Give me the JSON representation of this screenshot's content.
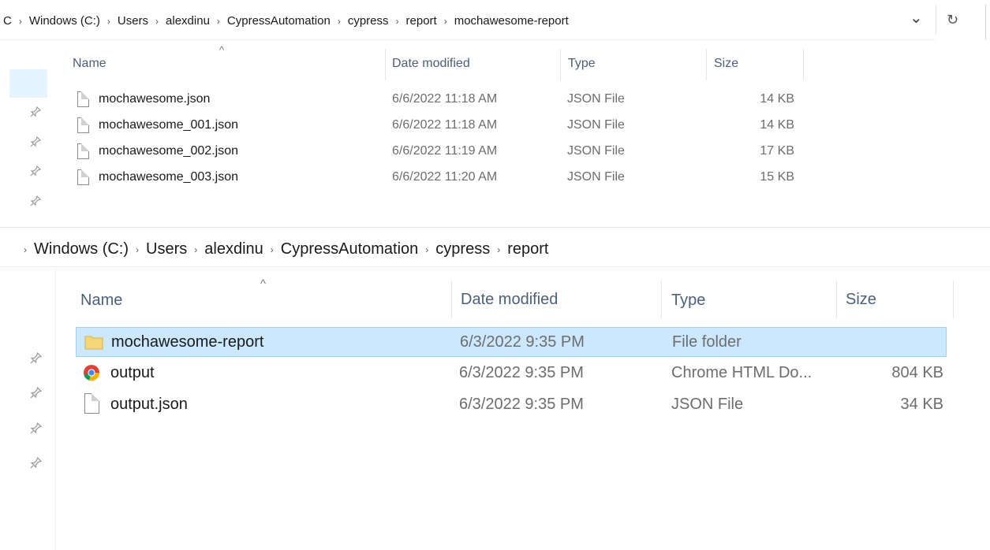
{
  "top": {
    "breadcrumb": [
      "C",
      "Windows (C:)",
      "Users",
      "alexdinu",
      "CypressAutomation",
      "cypress",
      "report",
      "mochawesome-report"
    ],
    "headers": {
      "name": "Name",
      "date": "Date modified",
      "type": "Type",
      "size": "Size"
    },
    "files": [
      {
        "name": "mochawesome.json",
        "date": "6/6/2022 11:18 AM",
        "type": "JSON File",
        "size": "14 KB"
      },
      {
        "name": "mochawesome_001.json",
        "date": "6/6/2022 11:18 AM",
        "type": "JSON File",
        "size": "14 KB"
      },
      {
        "name": "mochawesome_002.json",
        "date": "6/6/2022 11:19 AM",
        "type": "JSON File",
        "size": "17 KB"
      },
      {
        "name": "mochawesome_003.json",
        "date": "6/6/2022 11:20 AM",
        "type": "JSON File",
        "size": "15 KB"
      }
    ]
  },
  "bottom": {
    "breadcrumb": [
      "Windows (C:)",
      "Users",
      "alexdinu",
      "CypressAutomation",
      "cypress",
      "report"
    ],
    "headers": {
      "name": "Name",
      "date": "Date modified",
      "type": "Type",
      "size": "Size"
    },
    "files": [
      {
        "name": "mochawesome-report",
        "date": "6/3/2022 9:35 PM",
        "type": "File folder",
        "size": "",
        "icon": "folder-icon",
        "selected": true
      },
      {
        "name": "output",
        "date": "6/3/2022 9:35 PM",
        "type": "Chrome HTML Do...",
        "size": "804 KB",
        "icon": "chrome-icon"
      },
      {
        "name": "output.json",
        "date": "6/3/2022 9:35 PM",
        "type": "JSON File",
        "size": "34 KB",
        "icon": "file-icon"
      }
    ]
  },
  "icons": {
    "separator": "›",
    "dropdown": "⌄",
    "refresh": "↻",
    "sort_up": "^",
    "pin": "📌"
  },
  "colors": {
    "selection_bg": "#cce8ff",
    "selection_border": "#99d1ff",
    "header_text": "#4c607a",
    "folder": "#f3d57a"
  }
}
